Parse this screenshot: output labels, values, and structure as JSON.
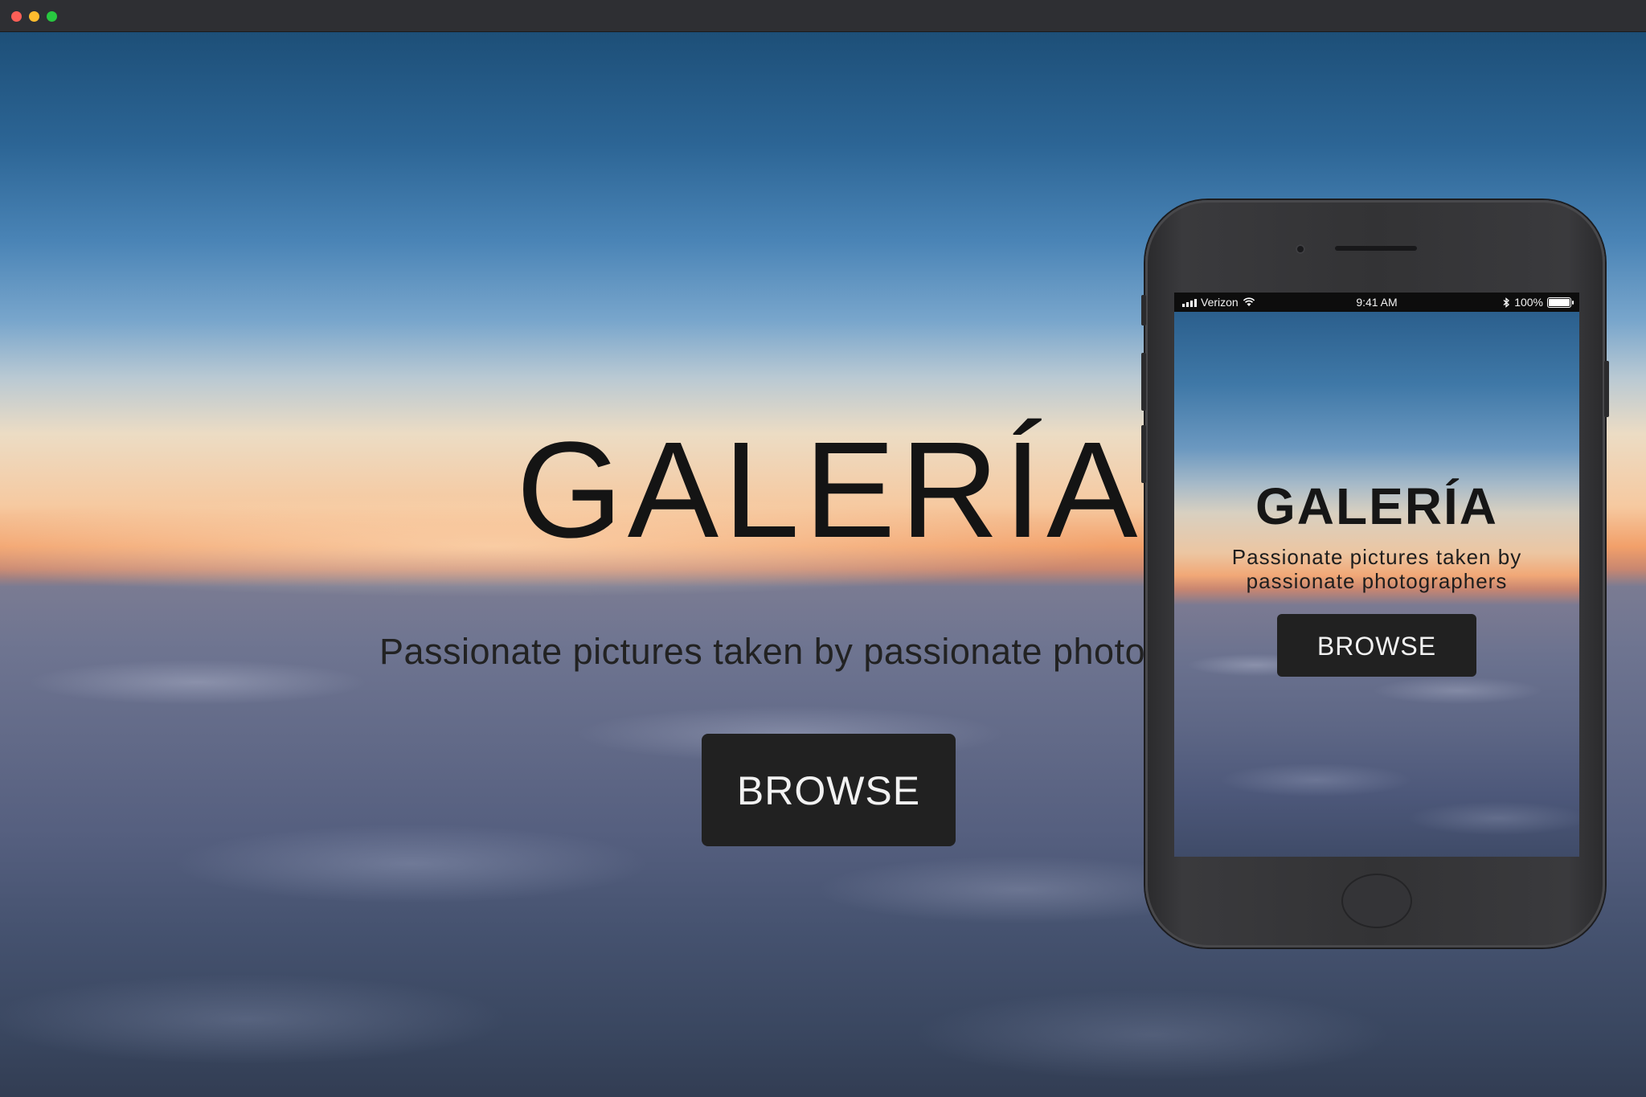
{
  "window": {
    "controls": [
      "close",
      "minimize",
      "zoom"
    ]
  },
  "desktop": {
    "title": "GALERÍA",
    "subtitle": "Passionate pictures taken by passionate photog",
    "browse_label": "BROWSE"
  },
  "phone": {
    "status": {
      "carrier": "Verizon",
      "time": "9:41 AM",
      "battery": "100%"
    },
    "title": "GALERÍA",
    "subtitle_line1": "Passionate pictures taken by",
    "subtitle_line2": "passionate photographers",
    "browse_label": "BROWSE"
  },
  "colors": {
    "button_bg": "#212121",
    "button_text": "#f2f2f2",
    "title_text": "#141414"
  }
}
